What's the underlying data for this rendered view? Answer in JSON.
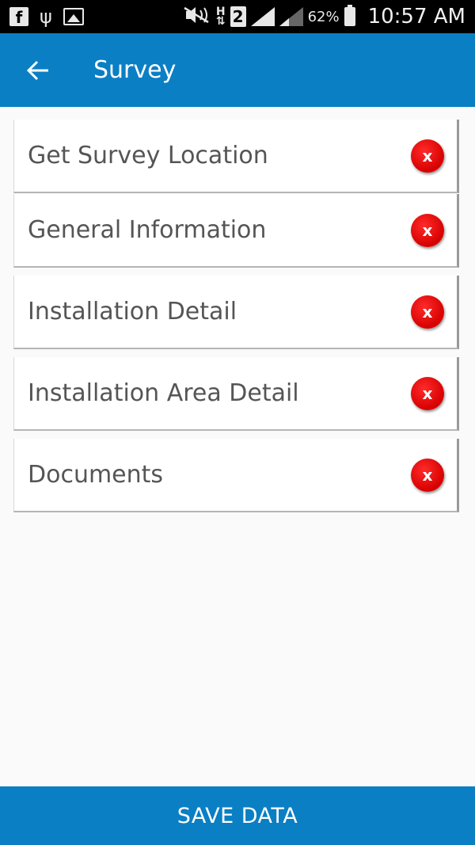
{
  "status_bar": {
    "sim_slot": "2",
    "battery_percent": "62%",
    "time": "10:57 AM",
    "icons": [
      "facebook-icon",
      "usb-icon",
      "image-icon",
      "mute-icon",
      "hspa-icon",
      "sim-icon",
      "signal-icon",
      "battery-icon"
    ]
  },
  "app_bar": {
    "title": "Survey",
    "back_icon": "arrow-left-icon",
    "color": "#0a7fc4"
  },
  "sections": [
    {
      "label": "Get Survey Location",
      "status": "x"
    },
    {
      "label": "General Information",
      "status": "x"
    },
    {
      "label": "Installation Detail",
      "status": "x"
    },
    {
      "label": "Installation Area Detail",
      "status": "x"
    },
    {
      "label": "Documents",
      "status": "x"
    }
  ],
  "status_color": "#e00000",
  "save_button": {
    "label": "SAVE DATA"
  }
}
